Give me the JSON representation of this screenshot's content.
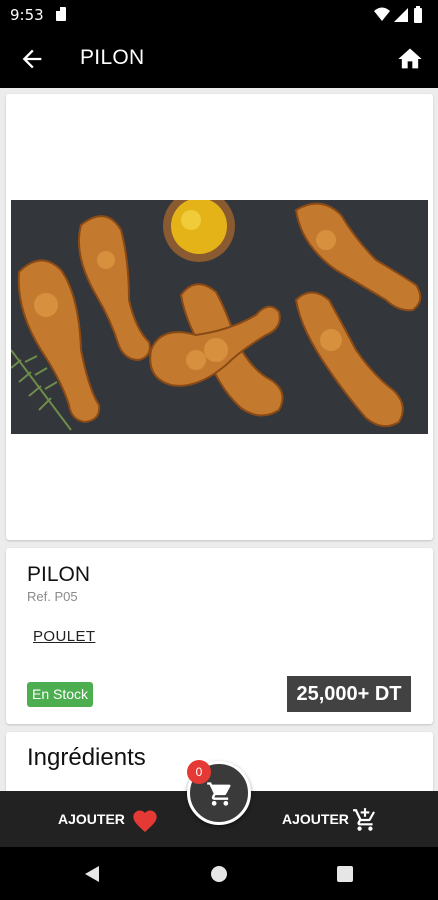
{
  "status_bar": {
    "time": "9:53"
  },
  "app_bar": {
    "title": "PILON"
  },
  "product": {
    "name": "PILON",
    "reference": "Ref. P05",
    "category": "POULET",
    "stock_status": "En Stock",
    "price": "25,000+ DT"
  },
  "ingredients": {
    "title": "Ingrédients"
  },
  "bottom_bar": {
    "favorite_label": "AJOUTER",
    "cart_add_label": "AJOUTER",
    "cart_count": "0"
  },
  "colors": {
    "app_bar": "#000000",
    "stock_badge": "#4cae4f",
    "price_tag": "#424242",
    "heart": "#e53935",
    "cart_badge": "#e53935",
    "bottom_bar": "#222222"
  },
  "icons": {
    "back": "arrow-left-icon",
    "home": "home-icon",
    "favorite": "heart-icon",
    "cart_add": "cart-plus-icon",
    "cart": "cart-icon"
  }
}
